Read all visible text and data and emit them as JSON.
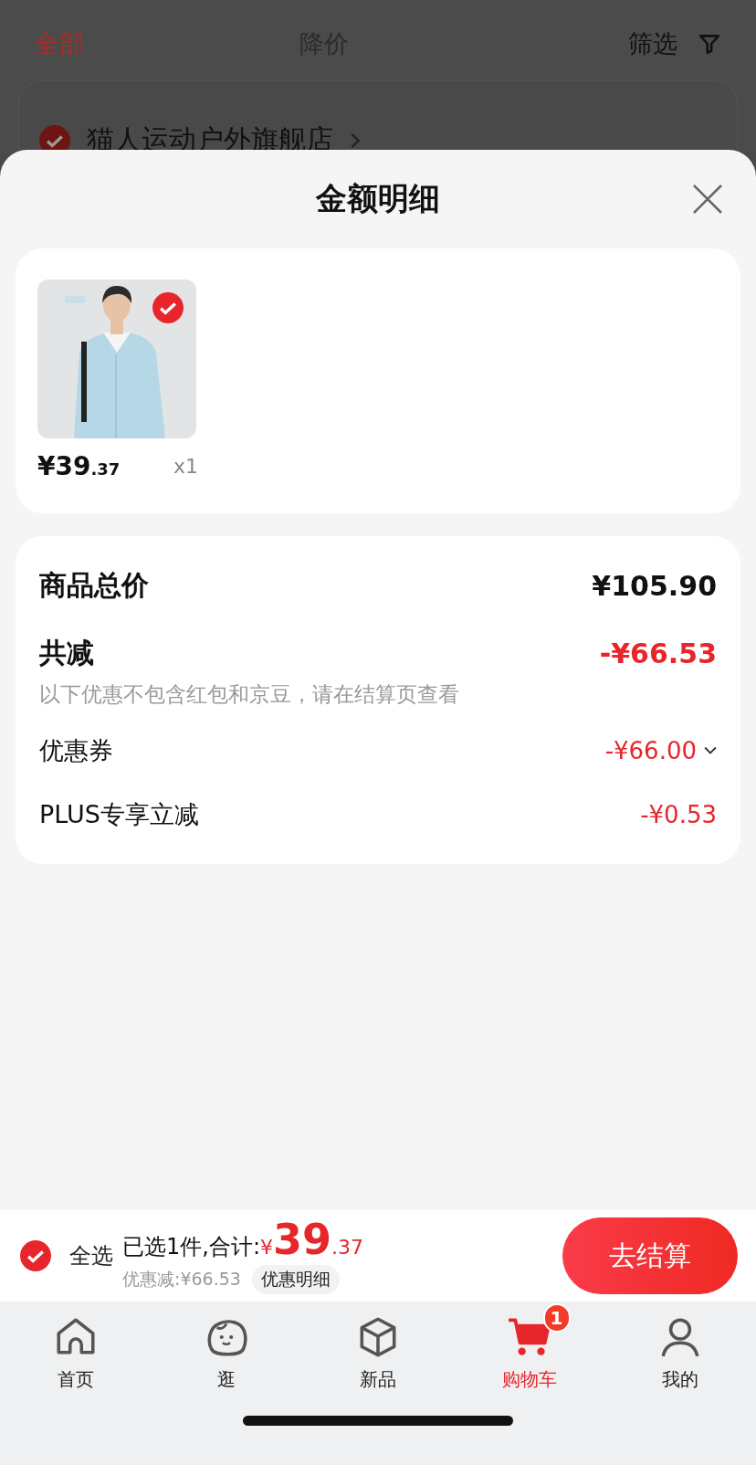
{
  "background": {
    "tabs": [
      {
        "label": "全部",
        "selected": true
      },
      {
        "label": "降价",
        "selected": false
      }
    ],
    "filter": {
      "label": "筛选"
    },
    "store": {
      "name": "猫人运动户外旗舰店",
      "checked": true
    }
  },
  "sheet": {
    "title": "金额明细",
    "items": [
      {
        "kind": "picture",
        "checked": true,
        "price_main": "¥39",
        "price_decimal": ".37",
        "quantity": "x1"
      }
    ],
    "summary": [
      {
        "kind": "total",
        "label": "商品总价",
        "amount": "¥105.90"
      },
      {
        "kind": "reduction",
        "label": "共减",
        "amount": "-¥66.53",
        "note": "以下优惠不包含红包和京豆，请在结算页查看"
      },
      {
        "kind": "discount",
        "label": "优惠券",
        "amount": "-¥66.00",
        "expandable": true
      },
      {
        "kind": "discount",
        "label": "PLUS专享立减",
        "amount": "-¥0.53",
        "expandable": false
      }
    ]
  },
  "checkout_bar": {
    "select_all": {
      "label": "全选",
      "checked": true
    },
    "selected_text": "已选1件,合计:",
    "total_currency": "¥",
    "total_main": "39",
    "total_decimal": ".37",
    "discount_text": "优惠减:¥66.53",
    "details_button": "优惠明细",
    "checkout_button": "去结算"
  },
  "tab_bar": [
    {
      "kind": "home",
      "label": "首页",
      "selected": false
    },
    {
      "kind": "browse",
      "label": "逛",
      "selected": false
    },
    {
      "kind": "new",
      "label": "新品",
      "selected": false
    },
    {
      "kind": "cart",
      "label": "购物车",
      "selected": true,
      "badge": "1"
    },
    {
      "kind": "me",
      "label": "我的",
      "selected": false
    }
  ]
}
